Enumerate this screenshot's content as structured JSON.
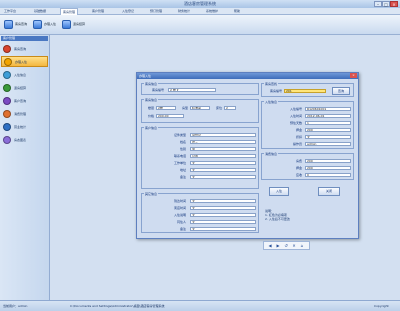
{
  "window": {
    "title": "酒店客房管理系统"
  },
  "menu": {
    "tabs": [
      "工作平台",
      "基础数据",
      "客房管理",
      "客户管理",
      "入住登记",
      "预订管理",
      "财务统计",
      "系统维护",
      "帮助"
    ]
  },
  "toolbar": {
    "buttons": [
      "客房查询",
      "办理入住",
      "退房结算"
    ]
  },
  "sidebar": {
    "header": "客户管理",
    "items": [
      {
        "label": "客房查询",
        "color": "#d9442e"
      },
      {
        "label": "办理入住",
        "color": "#f2a400"
      },
      {
        "label": "入住信息",
        "color": "#3f9ed8"
      },
      {
        "label": "退房结算",
        "color": "#3a9a3a"
      },
      {
        "label": "客户查询",
        "color": "#7b4bc3"
      },
      {
        "label": "消费管理",
        "color": "#e07030"
      },
      {
        "label": "营业统计",
        "color": "#2d6fc4"
      },
      {
        "label": "房态图表",
        "color": "#8a6dd8"
      }
    ]
  },
  "status": {
    "left": "当前用户：admin",
    "middle": "C:\\Documents and Settings\\Administrator\\桌面\\酒店客房管理系统",
    "right": "Copyright"
  },
  "dialog": {
    "title": "办理入住",
    "room_group": {
      "title": "客房信息",
      "label": "客房编号",
      "value": "2 楼  ▾"
    },
    "search_group": {
      "title": "客房查找",
      "label": "客房编号",
      "value": "201",
      "button": "查询"
    },
    "info_group": {
      "title": "客房信息",
      "fields": [
        {
          "label": "楼层",
          "value": "2楼"
        },
        {
          "label": "房型",
          "value": "标准间"
        },
        {
          "label": "床位",
          "value": "2"
        },
        {
          "label": "价格",
          "value": "200.00"
        }
      ]
    },
    "guest_group": {
      "title": "客户信息",
      "rows": [
        {
          "label": "证件类型",
          "value": "身份证"
        },
        {
          "label": "姓名",
          "value": "张三"
        },
        {
          "label": "性别",
          "value": "男"
        },
        {
          "label": "联系电话",
          "value": "138"
        },
        {
          "label": "工作单位",
          "value": "无"
        },
        {
          "label": "地址",
          "value": "无"
        },
        {
          "label": "备注",
          "value": "无"
        }
      ]
    },
    "checkin_group": {
      "title": "入住信息",
      "rows": [
        {
          "label": "入住编号",
          "value": "R120601001"
        },
        {
          "label": "入住时间",
          "value": "2012-06-01"
        },
        {
          "label": "预住天数",
          "value": "1"
        },
        {
          "label": "押金",
          "value": "200"
        },
        {
          "label": "折扣",
          "value": "无"
        },
        {
          "label": "操作员",
          "value": "admin"
        }
      ]
    },
    "cost_group": {
      "title": "消费信息",
      "rows": [
        {
          "label": "房费",
          "value": "200"
        },
        {
          "label": "押金",
          "value": "200"
        },
        {
          "label": "应收",
          "value": "0"
        }
      ]
    },
    "other_group": {
      "title": "其它信息",
      "rows": [
        {
          "label": "到达时间",
          "value": "无"
        },
        {
          "label": "离店时间",
          "value": "无"
        },
        {
          "label": "入住说明",
          "value": "无"
        },
        {
          "label": "同住人",
          "value": "无"
        },
        {
          "label": "备注",
          "value": "无"
        }
      ]
    },
    "buttons": {
      "ok": "入住",
      "cancel": "关闭"
    },
    "note": "说明：\n1. 红色为必填项\n2. 入住后不可更改"
  },
  "mini_controls": [
    "◀",
    "▶",
    "↺",
    "✕",
    "⌂"
  ]
}
